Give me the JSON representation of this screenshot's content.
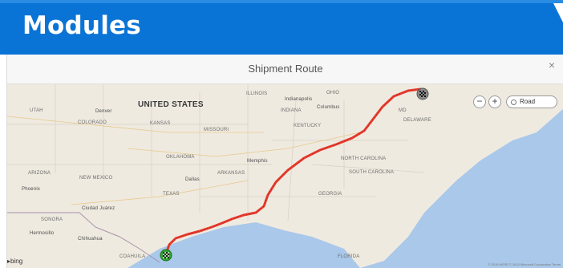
{
  "banner": {
    "title": "Modules",
    "color": "#0a74d6"
  },
  "dialog": {
    "title": "Shipment Route",
    "close_label": "×"
  },
  "map": {
    "style_label": "Road",
    "zoom_in_label": "+",
    "zoom_out_label": "−",
    "provider_label": "bing",
    "copyright": "© 2015 HERE © 2015 Microsoft Corporation  Terms",
    "route_color": "#e63b2e",
    "start_marker": "checkered-flag-green",
    "end_marker": "checkered-flag-gray",
    "labels": {
      "country": "UNITED STATES",
      "utah": "UTAH",
      "denver": "Denver",
      "colorado": "COLORADO",
      "kansas": "KANSAS",
      "missouri": "MISSOURI",
      "illinois": "ILLINOIS",
      "indiana": "INDIANA",
      "indianapolis": "Indianapolis",
      "ohio": "OHIO",
      "columbus": "Columbus",
      "kentucky": "KENTUCKY",
      "oklahoma": "OKLAHOMA",
      "arizona": "ARIZONA",
      "new_mexico": "NEW MEXICO",
      "phoenix": "Phoenix",
      "arkansas": "ARKANSAS",
      "memphis": "Memphis",
      "dallas": "Dallas",
      "texas": "TEXAS",
      "north_carolina": "NORTH CAROLINA",
      "south_carolina": "SOUTH CAROLINA",
      "georgia": "GEORGIA",
      "delaware": "DELAWARE",
      "md": "MD",
      "ciudad_juarez": "Ciudad Juárez",
      "sonora": "SONORA",
      "hermosillo": "Hermosillo",
      "chihuahua": "Chihuahua",
      "coahuila": "COAHUILA",
      "florida": "FLORIDA"
    }
  }
}
